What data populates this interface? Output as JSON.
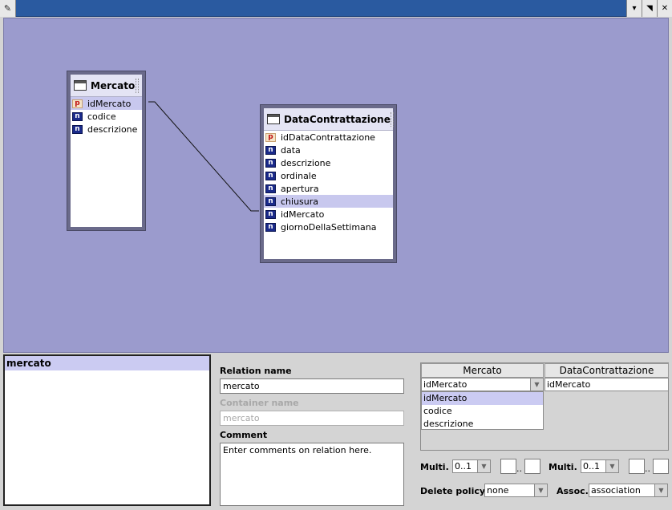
{
  "window": {
    "pin_glyph": "✎",
    "minimize_glyph": "▾",
    "maximize_glyph": "◥",
    "close_glyph": "✕"
  },
  "entities": [
    {
      "title": "Mercato",
      "attributes": [
        {
          "type": "p",
          "name": "idMercato",
          "selected": true
        },
        {
          "type": "n",
          "name": "codice",
          "selected": false
        },
        {
          "type": "n",
          "name": "descrizione",
          "selected": false
        }
      ]
    },
    {
      "title": "DataContrattazione",
      "attributes": [
        {
          "type": "p",
          "name": "idDataContrattazione",
          "selected": false
        },
        {
          "type": "n",
          "name": "data",
          "selected": false
        },
        {
          "type": "n",
          "name": "descrizione",
          "selected": false
        },
        {
          "type": "n",
          "name": "ordinale",
          "selected": false
        },
        {
          "type": "n",
          "name": "apertura",
          "selected": false
        },
        {
          "type": "n",
          "name": "chiusura",
          "selected": true
        },
        {
          "type": "n",
          "name": "idMercato",
          "selected": false
        },
        {
          "type": "n",
          "name": "giornoDellaSettimana",
          "selected": false
        }
      ]
    }
  ],
  "relations_list": {
    "items": [
      "mercato"
    ]
  },
  "relation_form": {
    "relation_name_label": "Relation name",
    "relation_name_value": "mercato",
    "container_name_label": "Container name",
    "container_name_value": "mercato",
    "comment_label": "Comment",
    "comment_value": "Enter comments on relation here."
  },
  "mapping": {
    "left_header": "Mercato",
    "right_header": "DataContrattazione",
    "left_selected": "idMercato",
    "left_options": [
      "idMercato",
      "codice",
      "descrizione"
    ],
    "right_value": "idMercato"
  },
  "bottom_controls": {
    "multi_label": "Multi.",
    "multi_left_value": "0..1",
    "multi_right_value": "0..1",
    "range_sep": "..",
    "delete_policy_label": "Delete policy",
    "delete_policy_value": "none",
    "assoc_label": "Assoc.",
    "assoc_value": "association"
  },
  "colors": {
    "canvas": "#9b9bcd",
    "titlebar": "#2a5aa0",
    "selection": "#cbcbf2"
  }
}
